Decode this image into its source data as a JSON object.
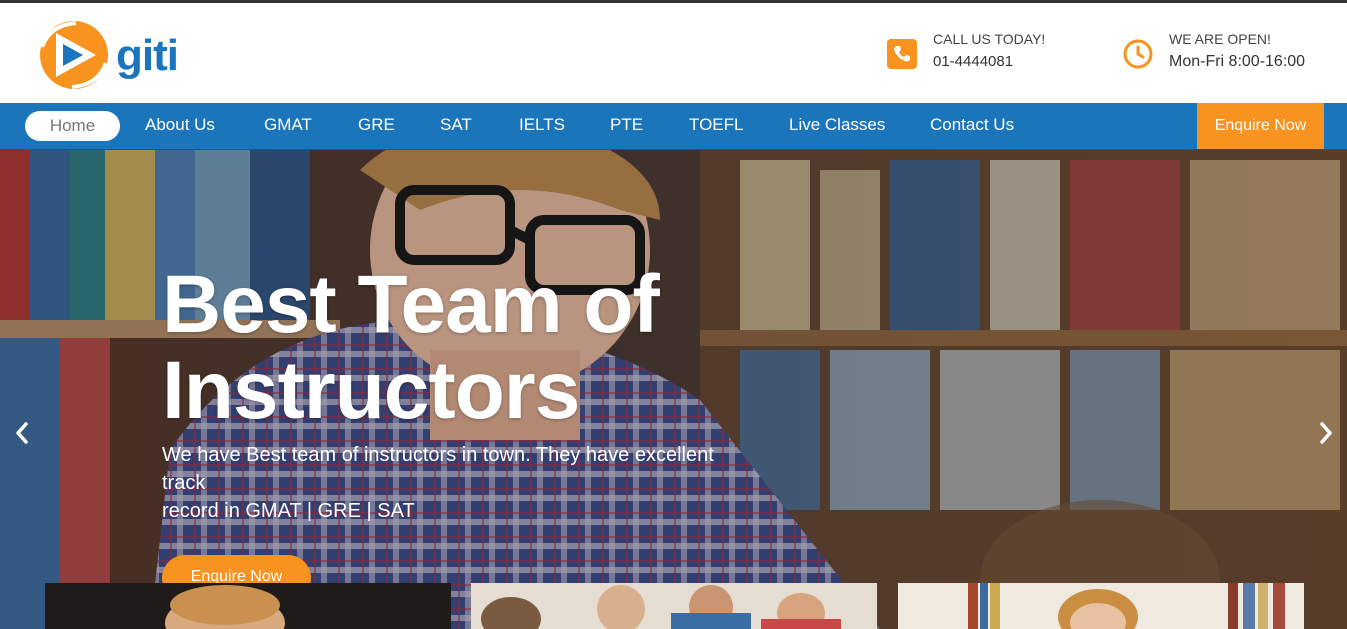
{
  "brand": {
    "name": "giti",
    "orange": "#f7931e",
    "blue": "#1a75bb"
  },
  "header": {
    "call": {
      "title": "CALL US TODAY!",
      "value": "01-4444081",
      "icon": "phone-icon"
    },
    "open": {
      "title": "WE ARE OPEN!",
      "value": "Mon-Fri 8:00-16:00",
      "icon": "clock-icon"
    }
  },
  "nav": {
    "home": "Home",
    "items": [
      "About Us",
      "GMAT",
      "GRE",
      "SAT",
      "IELTS",
      "PTE",
      "TOEFL",
      "Live Classes",
      "Contact Us"
    ],
    "cta": "Enquire Now"
  },
  "hero": {
    "title_line1": "Best Team of",
    "title_line2": "Instructors",
    "sub_line1": "We have Best team of instructors in town. They have excellent",
    "sub_line2": "track",
    "sub_line3": "record in GMAT | GRE | SAT",
    "button": "Enquire Now",
    "prev_icon": "chevron-left-icon",
    "next_icon": "chevron-right-icon"
  }
}
